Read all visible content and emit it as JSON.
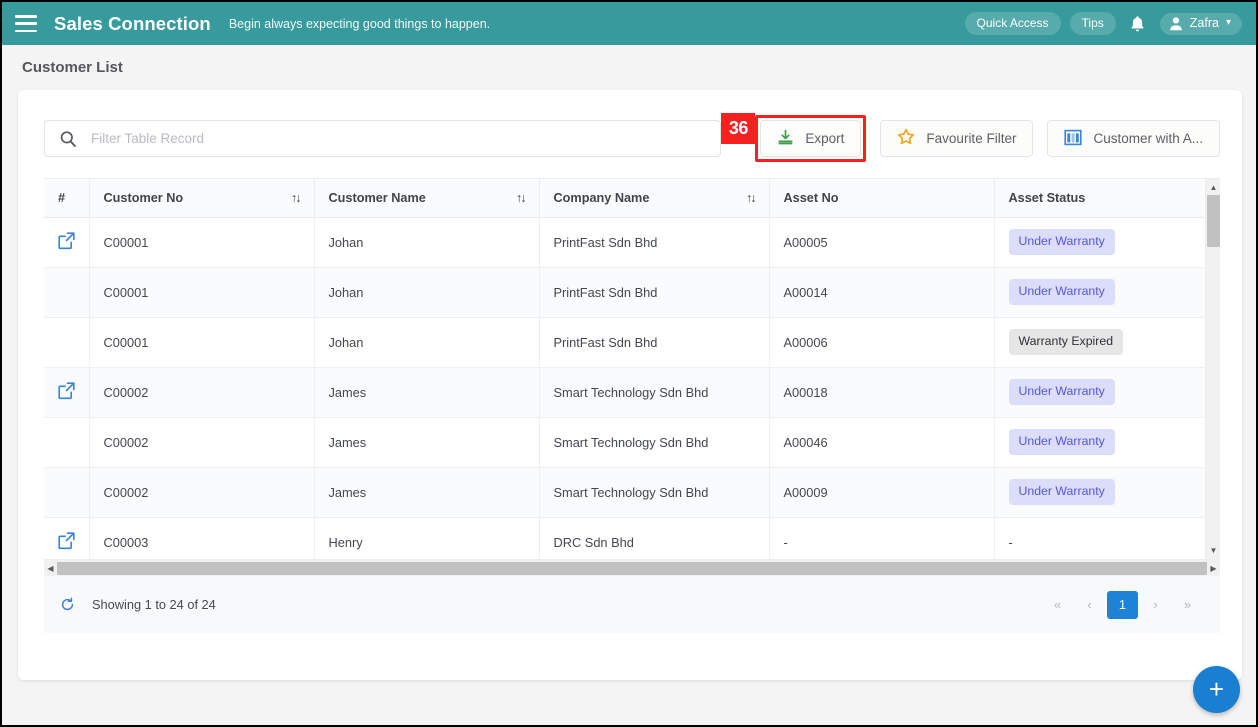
{
  "topbar": {
    "menu_icon": "hamburger-icon",
    "brand": "Sales Connection",
    "tagline": "Begin always expecting good things to happen.",
    "quick_access": "Quick Access",
    "tips": "Tips",
    "bell_icon": "bell-icon",
    "user_name": "Zafra",
    "user_icon": "person-icon",
    "caret": "▾"
  },
  "page": {
    "title": "Customer List"
  },
  "toolbar": {
    "search_placeholder": "Filter Table Record",
    "search_value": "",
    "search_icon": "search-icon",
    "annotation_number": "36",
    "export_label": "Export",
    "export_icon": "download-icon",
    "favourite_label": "Favourite Filter",
    "favourite_icon": "star-icon",
    "columns_label": "Customer with A...",
    "columns_icon": "columns-icon"
  },
  "table": {
    "columns": [
      {
        "key": "idx",
        "label": "#",
        "sortable": false
      },
      {
        "key": "customer_no",
        "label": "Customer No",
        "sortable": true
      },
      {
        "key": "customer_name",
        "label": "Customer Name",
        "sortable": true
      },
      {
        "key": "company_name",
        "label": "Company Name",
        "sortable": true
      },
      {
        "key": "asset_no",
        "label": "Asset No",
        "sortable": false
      },
      {
        "key": "asset_status",
        "label": "Asset Status",
        "sortable": false
      }
    ],
    "sort_icon": "↑↓",
    "open_icon": "external-link-icon",
    "rows": [
      {
        "open": true,
        "customer_no": "C00001",
        "customer_name": "Johan",
        "company_name": "PrintFast Sdn Bhd",
        "asset_no": "A00005",
        "asset_status": "Under Warranty",
        "status_kind": "warranty"
      },
      {
        "open": false,
        "customer_no": "C00001",
        "customer_name": "Johan",
        "company_name": "PrintFast Sdn Bhd",
        "asset_no": "A00014",
        "asset_status": "Under Warranty",
        "status_kind": "warranty"
      },
      {
        "open": false,
        "customer_no": "C00001",
        "customer_name": "Johan",
        "company_name": "PrintFast Sdn Bhd",
        "asset_no": "A00006",
        "asset_status": "Warranty Expired",
        "status_kind": "expired"
      },
      {
        "open": true,
        "customer_no": "C00002",
        "customer_name": "James",
        "company_name": "Smart Technology Sdn Bhd",
        "asset_no": "A00018",
        "asset_status": "Under Warranty",
        "status_kind": "warranty"
      },
      {
        "open": false,
        "customer_no": "C00002",
        "customer_name": "James",
        "company_name": "Smart Technology Sdn Bhd",
        "asset_no": "A00046",
        "asset_status": "Under Warranty",
        "status_kind": "warranty"
      },
      {
        "open": false,
        "customer_no": "C00002",
        "customer_name": "James",
        "company_name": "Smart Technology Sdn Bhd",
        "asset_no": "A00009",
        "asset_status": "Under Warranty",
        "status_kind": "warranty"
      },
      {
        "open": true,
        "customer_no": "C00003",
        "customer_name": "Henry",
        "company_name": "DRC Sdn Bhd",
        "asset_no": "-",
        "asset_status": "-",
        "status_kind": "plain"
      }
    ]
  },
  "footer": {
    "refresh_icon": "refresh-icon",
    "showing_text": "Showing 1 to 24 of 24",
    "pager": [
      {
        "label": "«",
        "active": false,
        "name": "pager-first"
      },
      {
        "label": "‹",
        "active": false,
        "name": "pager-prev"
      },
      {
        "label": "1",
        "active": true,
        "name": "pager-page-1"
      },
      {
        "label": "›",
        "active": false,
        "name": "pager-next"
      },
      {
        "label": "»",
        "active": false,
        "name": "pager-last"
      }
    ]
  },
  "fab": {
    "label": "+",
    "icon": "plus-icon"
  },
  "colors": {
    "header_teal": "#379a9d",
    "accent_blue": "#1b7fd1",
    "annotation_red": "#f42121",
    "badge_warranty_bg": "#dcdcfb",
    "badge_warranty_text": "#5656e0",
    "badge_expired_bg": "#e6e6e6"
  }
}
